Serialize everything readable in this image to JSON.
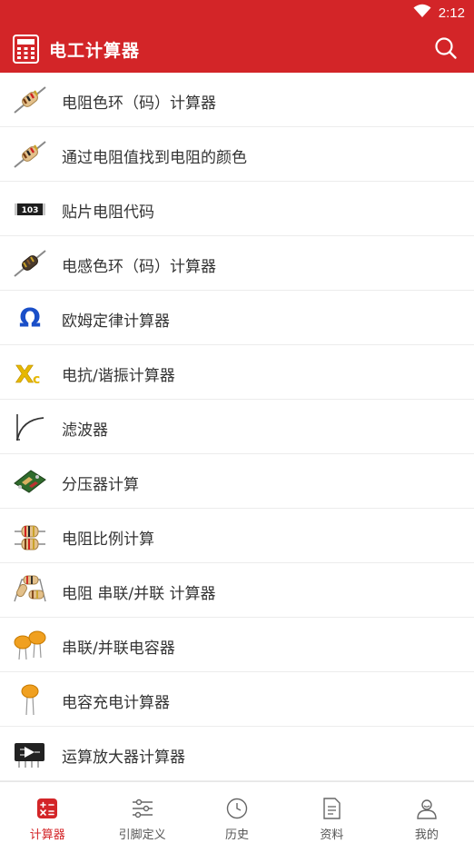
{
  "status_bar": {
    "time": "2:12"
  },
  "app_bar": {
    "title": "电工计算器"
  },
  "list": [
    {
      "label": "电阻色环（码）计算器",
      "icon": "resistor-icon"
    },
    {
      "label": "通过电阻值找到电阻的颜色",
      "icon": "resistor-icon"
    },
    {
      "label": "贴片电阻代码",
      "icon": "smd-resistor-icon",
      "icon_text": "103"
    },
    {
      "label": "电感色环（码）计算器",
      "icon": "inductor-icon"
    },
    {
      "label": "欧姆定律计算器",
      "icon": "omega-icon",
      "icon_text": "Ω"
    },
    {
      "label": "电抗/谐振计算器",
      "icon": "reactance-icon",
      "icon_text": "X",
      "icon_sub": "c"
    },
    {
      "label": "滤波器",
      "icon": "filter-curve-icon"
    },
    {
      "label": "分压器计算",
      "icon": "voltage-divider-board-icon"
    },
    {
      "label": "电阻比例计算",
      "icon": "resistor-pair-icon"
    },
    {
      "label": "电阻 串联/并联 计算器",
      "icon": "resistor-network-icon"
    },
    {
      "label": "串联/并联电容器",
      "icon": "capacitor-pair-icon"
    },
    {
      "label": "电容充电计算器",
      "icon": "capacitor-icon"
    },
    {
      "label": "运算放大器计算器",
      "icon": "op-amp-chip-icon"
    }
  ],
  "bottom_nav": [
    {
      "label": "计算器",
      "icon": "calculator-icon",
      "active": true
    },
    {
      "label": "引脚定义",
      "icon": "sliders-icon",
      "active": false
    },
    {
      "label": "历史",
      "icon": "clock-icon",
      "active": false
    },
    {
      "label": "资料",
      "icon": "document-icon",
      "active": false
    },
    {
      "label": "我的",
      "icon": "user-icon",
      "active": false
    }
  ],
  "colors": {
    "primary": "#d32528",
    "text": "#333333",
    "divider": "#ececec"
  }
}
